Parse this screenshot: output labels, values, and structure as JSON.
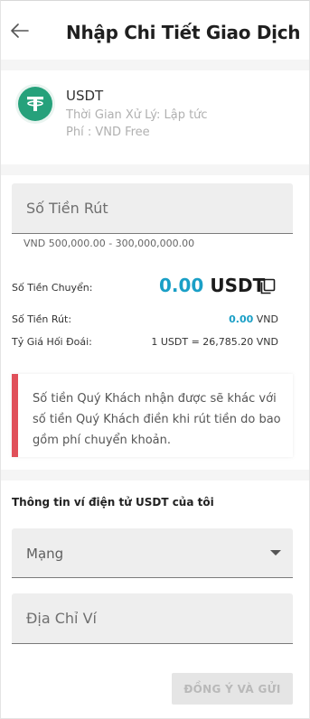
{
  "header": {
    "title": "Nhập Chi Tiết Giao Dịch",
    "back_icon": "arrow-left-icon"
  },
  "currency": {
    "icon": "tether-icon",
    "brand_color": "#26a17b",
    "name": "USDT",
    "processing_time": "Thời Gian Xử Lý: Lập tức",
    "fee": "Phí : VND Free"
  },
  "amount": {
    "placeholder": "Số Tiền Rút",
    "value": "",
    "range_hint": "VND 500,000.00 - 300,000,000.00",
    "transfer_label": "Số Tiền Chuyển:",
    "transfer_value": "0.00",
    "transfer_unit": "USDT",
    "copy_icon": "copy-icon",
    "withdraw_label": "Số Tiền Rút:",
    "withdraw_value": "0.00",
    "withdraw_unit": "VND",
    "rate_label": "Tỷ Giá Hối Đoái:",
    "rate_value": "1 USDT = 26,785.20 VND",
    "accent_color": "#1a9fc6"
  },
  "notice": {
    "text": "Số tiền Quý Khách nhận được sẽ khác với số tiền Quý Khách điền khi rút tiền do bao gồm phí chuyển khoản.",
    "bar_color": "#e0505a"
  },
  "wallet": {
    "section_title": "Thông tin ví điện tử USDT của tôi",
    "network_label": "Mạng",
    "address_placeholder": "Địa Chỉ Ví",
    "address_value": ""
  },
  "submit": {
    "label": "ĐỒNG Ý VÀ GỬI",
    "enabled": false
  }
}
